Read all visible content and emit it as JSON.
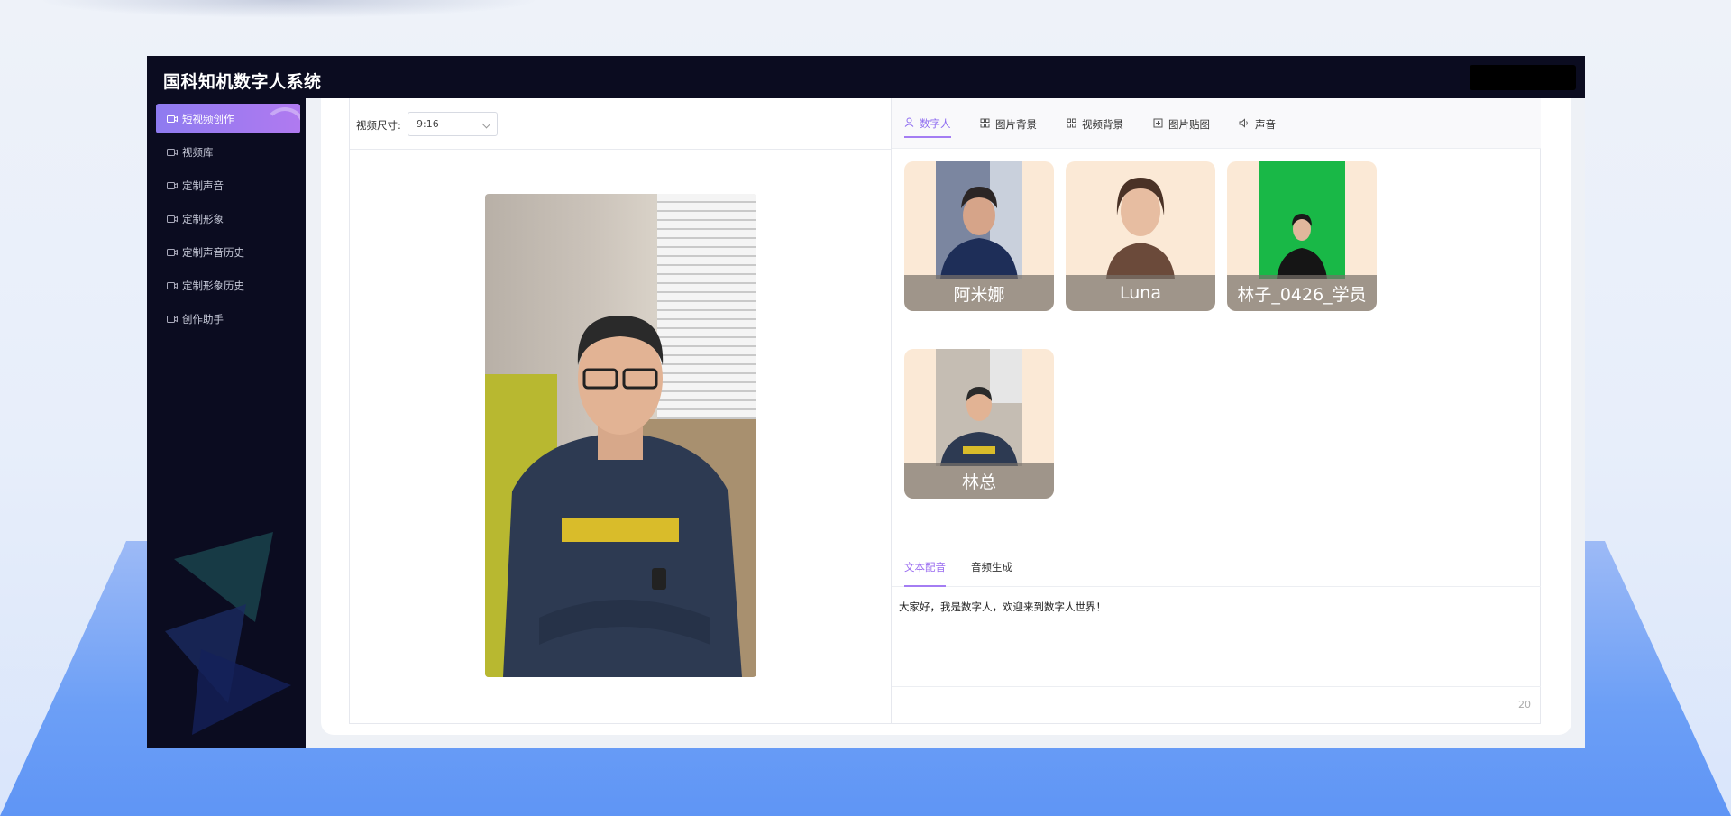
{
  "app": {
    "title": "国科知机数字人系统"
  },
  "sidebar": {
    "items": [
      {
        "label": "短视频创作",
        "active": true
      },
      {
        "label": "视频库"
      },
      {
        "label": "定制声音"
      },
      {
        "label": "定制形象"
      },
      {
        "label": "定制声音历史"
      },
      {
        "label": "定制形象历史"
      },
      {
        "label": "创作助手"
      }
    ]
  },
  "video_size": {
    "label": "视频尺寸:",
    "value": "9:16"
  },
  "tabs": [
    {
      "label": "数字人",
      "icon": "user-icon",
      "active": true
    },
    {
      "label": "图片背景",
      "icon": "grid-icon"
    },
    {
      "label": "视频背景",
      "icon": "grid-icon"
    },
    {
      "label": "图片贴图",
      "icon": "plus-square-icon"
    },
    {
      "label": "声音",
      "icon": "speaker-icon"
    }
  ],
  "avatars": [
    {
      "name": "阿米娜"
    },
    {
      "name": "Luna"
    },
    {
      "name": "林子_0426_学员"
    },
    {
      "name": "林总"
    }
  ],
  "sub_tabs": [
    {
      "label": "文本配音",
      "active": true
    },
    {
      "label": "音频生成"
    }
  ],
  "script_text": "大家好，我是数字人，欢迎来到数字人世界！",
  "char_count": "20",
  "colors": {
    "accent": "#a47df3",
    "sidebar_bg": "#0b0c20",
    "card_bg": "#fbe9d6"
  }
}
